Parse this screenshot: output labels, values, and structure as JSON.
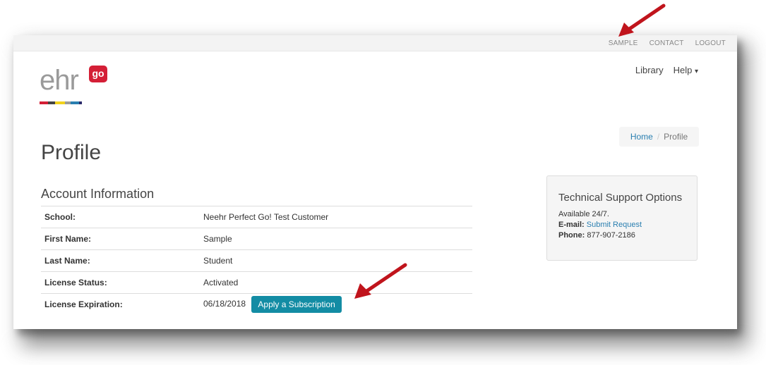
{
  "topbar": {
    "links": [
      "SAMPLE",
      "CONTACT",
      "LOGOUT"
    ]
  },
  "logo": {
    "text": "ehr",
    "badge": "go",
    "stripe_colors": [
      "#d41f36",
      "#444444",
      "#f2d21b",
      "#9a9a9a",
      "#2a7fb0"
    ]
  },
  "nav": {
    "library": "Library",
    "help": "Help",
    "help_caret": "▾"
  },
  "breadcrumb": {
    "home": "Home",
    "separator": "/",
    "current": "Profile"
  },
  "page": {
    "title": "Profile",
    "section_title": "Account Information"
  },
  "account": {
    "rows": [
      {
        "label": "School:",
        "value": "Neehr Perfect Go! Test Customer"
      },
      {
        "label": "First Name:",
        "value": "Sample"
      },
      {
        "label": "Last Name:",
        "value": "Student"
      },
      {
        "label": "License Status:",
        "value": "Activated"
      },
      {
        "label": "License Expiration:",
        "value": "06/18/2018"
      }
    ],
    "apply_button": "Apply a Subscription"
  },
  "support": {
    "title": "Technical Support Options",
    "availability": "Available 24/7.",
    "email_label": "E-mail:",
    "email_link": "Submit Request",
    "phone_label": "Phone:",
    "phone_value": "877-907-2186"
  },
  "colors": {
    "accent": "#138ca4",
    "link": "#2a7fb0",
    "brand_red": "#d41f36",
    "annotation_arrow": "#c0141c"
  }
}
